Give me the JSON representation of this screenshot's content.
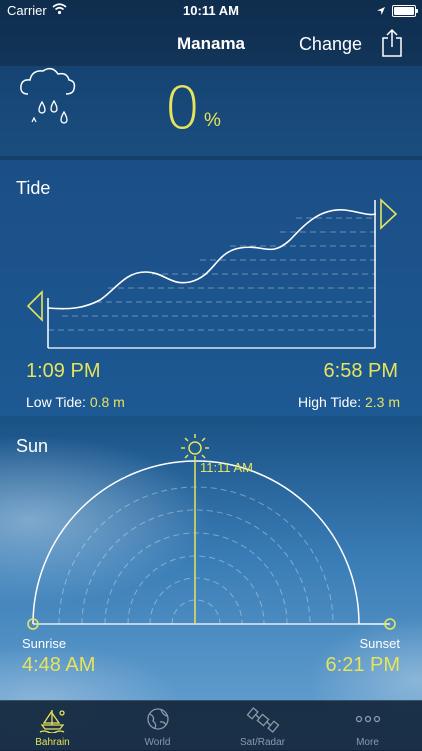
{
  "status_bar": {
    "carrier": "Carrier",
    "time": "10:11 AM"
  },
  "nav": {
    "title": "Manama",
    "change_label": "Change"
  },
  "precipitation": {
    "value": "0",
    "unit": "%"
  },
  "tide": {
    "title": "Tide",
    "low_time": "1:09 PM",
    "high_time": "6:58 PM",
    "low_label": "Low Tide:",
    "low_value": "0.8 m",
    "high_label": "High Tide:",
    "high_value": "2.3 m"
  },
  "sun": {
    "title": "Sun",
    "noon_time": "11:11 AM",
    "sunrise_label": "Sunrise",
    "sunrise_time": "4:48 AM",
    "sunset_label": "Sunset",
    "sunset_time": "6:21 PM"
  },
  "tabs": [
    {
      "label": "Bahrain",
      "icon": "boat-icon",
      "active": true
    },
    {
      "label": "World",
      "icon": "globe-icon",
      "active": false
    },
    {
      "label": "Sat/Radar",
      "icon": "satellite-icon",
      "active": false
    },
    {
      "label": "More",
      "icon": "more-dots-icon",
      "active": false
    }
  ],
  "colors": {
    "accent": "#e6e35c",
    "text": "#ffffff",
    "tab_inactive": "#8c9aab"
  }
}
